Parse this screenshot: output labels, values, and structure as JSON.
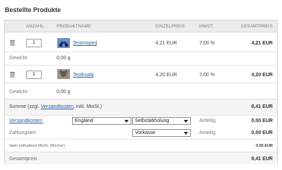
{
  "page": {
    "title": "Bestellte Produkte"
  },
  "table": {
    "headers": {
      "anzahl": "ANZAHL",
      "produktname": "PRODUKTNAME",
      "einzelpreis": "EINZELPREIS",
      "mwst": "MWST.",
      "gesamtpreis": "GESAMTPREIS"
    },
    "products": [
      {
        "qty": "1",
        "name": "Testmoped",
        "unit_price": "4,21 EUR",
        "vat": "7,00 %",
        "total": "4,21 EUR",
        "weight_label": "Gewicht:",
        "weight": "0,00 g",
        "thumb_color": "#3b5f9e"
      },
      {
        "qty": "1",
        "name": "Testkoala",
        "unit_price": "4,20 EUR",
        "vat": "7,00 %",
        "total": "4,20 EUR",
        "weight_label": "Gewicht:",
        "weight": "0,00 g",
        "thumb_color": "#8a8275"
      }
    ],
    "summary": {
      "sum_prefix": "Summe (zzgl. ",
      "sum_link": "Versandkosten",
      "sum_suffix": ", inkl. MwSt.)",
      "sum_value": "8,41 EUR",
      "shipping_label": "Versandkosten:",
      "country_selected": "England",
      "shipping_method_selected": "Selbstabholung",
      "shipping_share": "Anteilig",
      "shipping_value": "0,00 EUR",
      "payment_label": "Zahlungsart:",
      "payment_selected": "Vorkasse",
      "payment_share": "Anteilig",
      "payment_value": "0,00 EUR",
      "vat_note": "darin enthaltene MwSt. (Bücher)",
      "vat_value": "0,55 EUR",
      "total_label": "Gesamtpreis",
      "total_value": "8,41 EUR"
    }
  },
  "colors": {
    "link": "#1f5fa8",
    "header_bg": "#ececec"
  },
  "icons": {
    "delete": "trash-icon"
  }
}
